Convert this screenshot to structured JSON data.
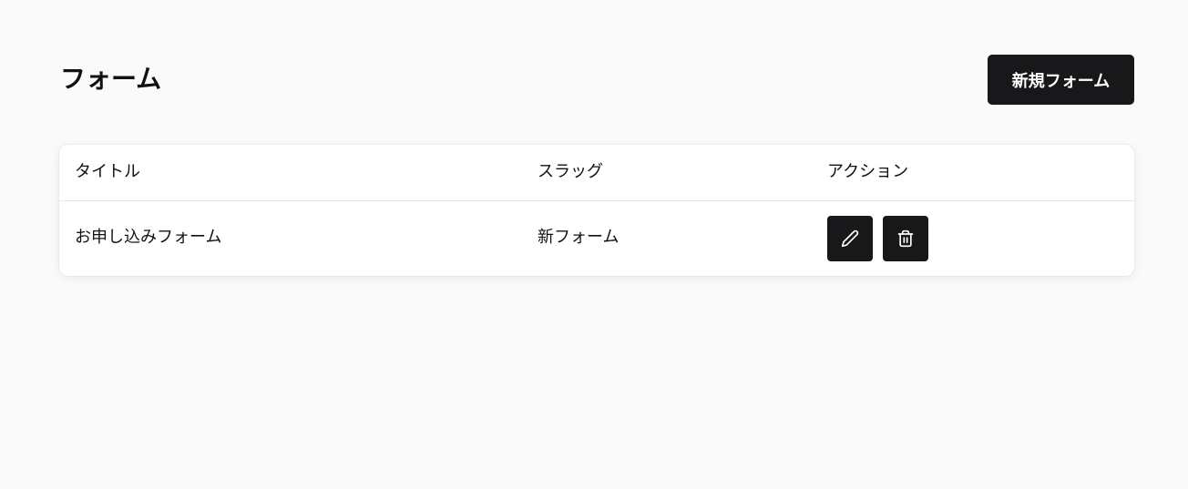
{
  "header": {
    "title": "フォーム",
    "new_button_label": "新規フォーム"
  },
  "table": {
    "columns": [
      "タイトル",
      "スラッグ",
      "アクション"
    ],
    "rows": [
      {
        "title": "お申し込みフォーム",
        "slug": "新フォーム",
        "actions": [
          "pencil-icon",
          "trash-icon"
        ]
      }
    ]
  },
  "colors": {
    "background": "#fafafa",
    "button": "#18181b",
    "button_text": "#ffffff",
    "card": "#ffffff",
    "divider": "#e5e5e5"
  }
}
